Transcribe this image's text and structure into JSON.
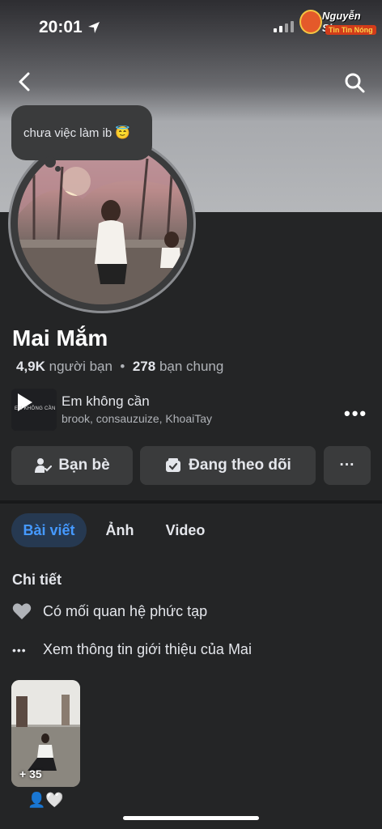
{
  "status": {
    "time": "20:01"
  },
  "watermark": {
    "name": "Nguyễn Sin",
    "sub": "Tin Tin Nóng"
  },
  "profile": {
    "note": "chưa việc làm ib 😇",
    "name": "Mai Mắm",
    "friends_count": "4,9K",
    "friends_label": "người bạn",
    "separator": "•",
    "mutual_count": "278",
    "mutual_label": "bạn chung"
  },
  "music": {
    "title": "Em không cần",
    "artists": "brook, consauzuize, KhoaiTay",
    "cover_text": "EM KHÔNG CẦN",
    "more": "•••"
  },
  "actions": {
    "friends_label": "Bạn bè",
    "following_label": "Đang theo dõi",
    "more_label": "···"
  },
  "tabs": [
    {
      "label": "Bài viết",
      "active": true
    },
    {
      "label": "Ảnh",
      "active": false
    },
    {
      "label": "Video",
      "active": false
    }
  ],
  "details": {
    "title": "Chi tiết",
    "relationship": "Có mối quan hệ phức tạp",
    "see_about": "Xem thông tin giới thiệu của Mai",
    "more_icon": "•••"
  },
  "featured": {
    "count": "+ 35",
    "caption": "👤🤍"
  },
  "colors": {
    "accent": "#4599ff",
    "background": "#242526",
    "button": "#3a3b3c"
  }
}
